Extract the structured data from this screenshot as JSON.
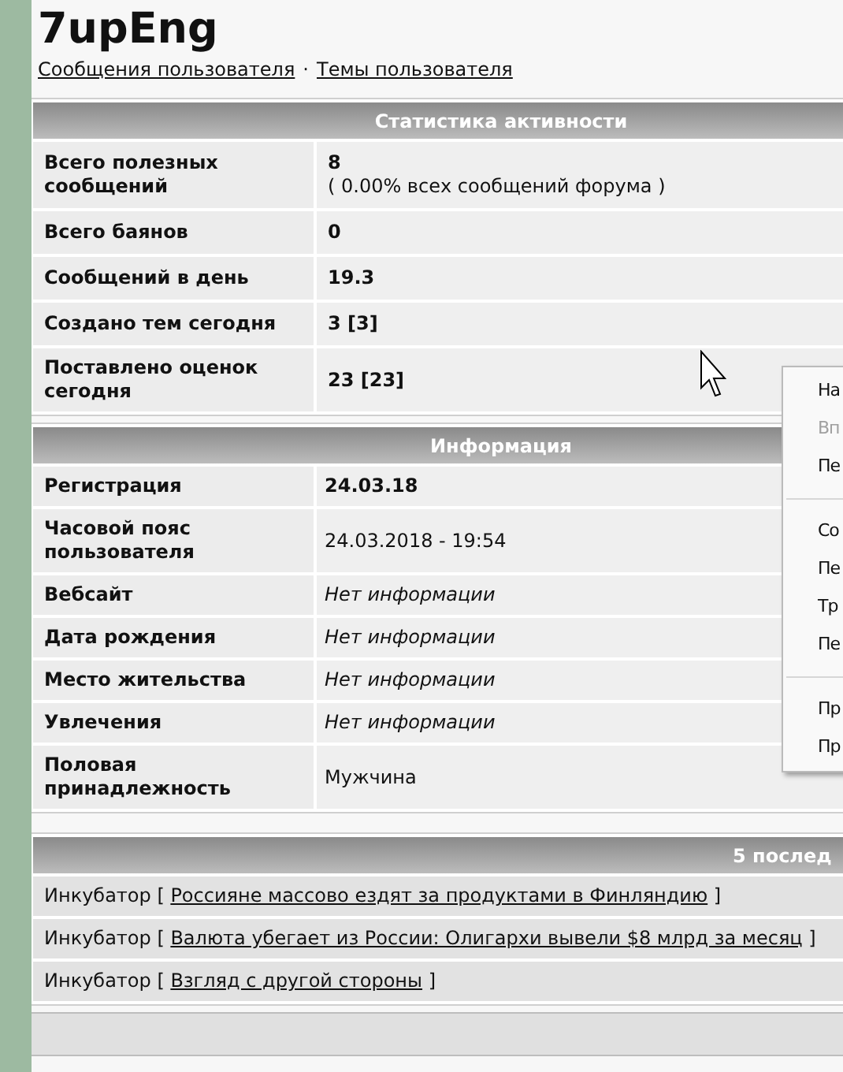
{
  "title": "7upEng",
  "links": [
    "Сообщения пользователя",
    "Темы пользователя"
  ],
  "link_separator": "·",
  "stats": {
    "header": "Статистика активности",
    "rows": [
      {
        "label": "Всего полезных сообщений",
        "value": "8",
        "note": "( 0.00% всех сообщений форума )"
      },
      {
        "label": "Всего баянов",
        "value": "0"
      },
      {
        "label": "Сообщений в день",
        "value": "19.3"
      },
      {
        "label": "Создано тем сегодня",
        "value": "3 [3]"
      },
      {
        "label": "Поставлено оценок сегодня",
        "value": "23 [23]"
      }
    ]
  },
  "info": {
    "header": "Информация",
    "rows": [
      {
        "label": "Регистрация",
        "value": "24.03.18",
        "kind": "bold"
      },
      {
        "label": "Часовой пояс пользователя",
        "value": "24.03.2018 - 19:54",
        "kind": "plain"
      },
      {
        "label": "Вебсайт",
        "value": "Нет информации",
        "kind": "italic"
      },
      {
        "label": "Дата рождения",
        "value": "Нет информации",
        "kind": "italic"
      },
      {
        "label": "Место жительства",
        "value": "Нет информации",
        "kind": "italic"
      },
      {
        "label": "Увлечения",
        "value": "Нет информации",
        "kind": "italic"
      },
      {
        "label": "Половая принадлежность",
        "value": "Мужчина",
        "kind": "plain"
      }
    ]
  },
  "recent": {
    "header": "5 послед",
    "rows": [
      {
        "forum": "Инкубатор",
        "open": "[",
        "topic": "Россияне массово ездят за продуктами в Финляндию",
        "close": "]"
      },
      {
        "forum": "Инкубатор",
        "open": "[",
        "topic": "Валюта убегает из России: Олигархи вывели $8 млрд за месяц",
        "close": "]"
      },
      {
        "forum": "Инкубатор",
        "open": "[",
        "topic": "Взгляд с другой стороны",
        "close": "]"
      }
    ]
  },
  "context_menu": {
    "items": [
      {
        "kind": "item",
        "label": "На",
        "disabled": false
      },
      {
        "kind": "item",
        "label": "Вп",
        "disabled": true
      },
      {
        "kind": "item",
        "label": "Пе",
        "disabled": false
      },
      {
        "kind": "separator"
      },
      {
        "kind": "item",
        "label": "Со",
        "disabled": false
      },
      {
        "kind": "item",
        "label": "Пе",
        "disabled": false
      },
      {
        "kind": "item",
        "label": "Тр",
        "disabled": false
      },
      {
        "kind": "item",
        "label": "Пе",
        "disabled": false
      },
      {
        "kind": "separator"
      },
      {
        "kind": "item",
        "label": "Пр",
        "disabled": false
      },
      {
        "kind": "item",
        "label": "Пр",
        "disabled": false
      }
    ]
  }
}
